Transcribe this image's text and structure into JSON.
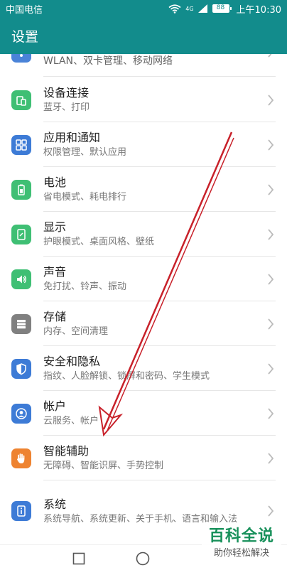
{
  "status_bar": {
    "carrier": "中国电信",
    "signal_label": "4G",
    "battery": "88",
    "time": "上午10:30"
  },
  "header": {
    "title": "设置"
  },
  "settings": [
    {
      "title": "",
      "subtitle": "WLAN、双卡管理、移动网络",
      "icon": "network-icon",
      "color": "#4a83d8"
    },
    {
      "title": "设备连接",
      "subtitle": "蓝牙、打印",
      "icon": "device-connection-icon",
      "color": "#3fbf74"
    },
    {
      "title": "应用和通知",
      "subtitle": "权限管理、默认应用",
      "icon": "apps-icon",
      "color": "#3d7bd6"
    },
    {
      "title": "电池",
      "subtitle": "省电模式、耗电排行",
      "icon": "battery-icon",
      "color": "#3fbf74"
    },
    {
      "title": "显示",
      "subtitle": "护眼模式、桌面风格、壁纸",
      "icon": "display-icon",
      "color": "#3fbf74"
    },
    {
      "title": "声音",
      "subtitle": "免打扰、铃声、振动",
      "icon": "sound-icon",
      "color": "#3fbf74"
    },
    {
      "title": "存储",
      "subtitle": "内存、空间清理",
      "icon": "storage-icon",
      "color": "#808080"
    },
    {
      "title": "安全和隐私",
      "subtitle": "指纹、人脸解锁、锁屏和密码、学生模式",
      "icon": "shield-icon",
      "color": "#3d7bd6"
    },
    {
      "title": "帐户",
      "subtitle": "云服务、帐户",
      "icon": "account-icon",
      "color": "#3d7bd6"
    },
    {
      "title": "智能辅助",
      "subtitle": "无障碍、智能识屏、手势控制",
      "icon": "hand-icon",
      "color": "#ee8330"
    },
    {
      "title": "系统",
      "subtitle": "系统导航、系统更新、关于手机、语言和输入法",
      "icon": "system-info-icon",
      "color": "#3d7bd6"
    }
  ],
  "watermark": {
    "title": "百科全说",
    "subtitle": "助你轻松解决"
  },
  "colors": {
    "accent": "#128c8c",
    "arrow": "#c8212a"
  }
}
